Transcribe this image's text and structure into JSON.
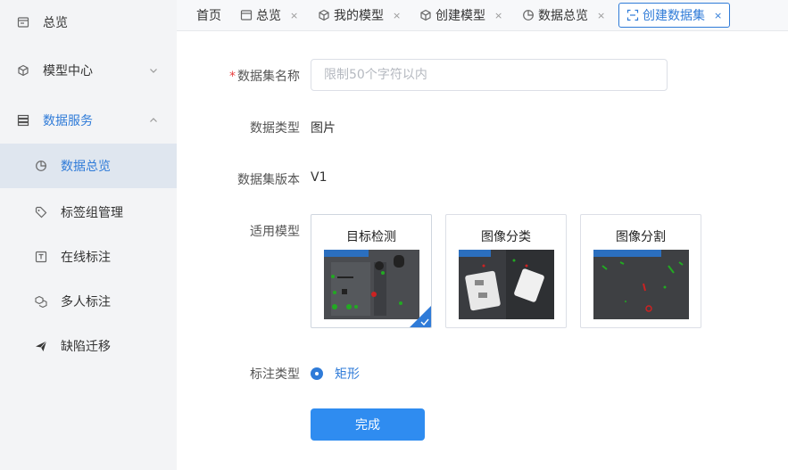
{
  "sidebar": {
    "items": [
      {
        "label": "总览",
        "icon": "overview-icon"
      },
      {
        "label": "模型中心",
        "icon": "cube-icon"
      },
      {
        "label": "数据服务",
        "icon": "database-icon"
      },
      {
        "label": "数据总览",
        "icon": "pie-chart-icon"
      },
      {
        "label": "标签组管理",
        "icon": "tag-icon"
      },
      {
        "label": "在线标注",
        "icon": "text-box-icon"
      },
      {
        "label": "多人标注",
        "icon": "multi-cube-icon"
      },
      {
        "label": "缺陷迁移",
        "icon": "send-icon"
      }
    ]
  },
  "tabs": [
    {
      "label": "首页"
    },
    {
      "label": "总览",
      "close": "×"
    },
    {
      "label": "我的模型",
      "close": "×"
    },
    {
      "label": "创建模型",
      "close": "×"
    },
    {
      "label": "数据总览",
      "close": "×"
    },
    {
      "label": "创建数据集",
      "close": "×"
    }
  ],
  "form": {
    "required_mark": "*",
    "name_label": "数据集名称",
    "name_placeholder": "限制50个字符以内",
    "name_value": "",
    "type_label": "数据类型",
    "type_value": "图片",
    "version_label": "数据集版本",
    "version_value": "V1",
    "model_label": "适用模型",
    "models": [
      {
        "title": "目标检测",
        "selected": true
      },
      {
        "title": "图像分类",
        "selected": false
      },
      {
        "title": "图像分割",
        "selected": false
      }
    ],
    "annotation_label": "标注类型",
    "annotation_option": "矩形",
    "submit_label": "完成"
  },
  "colors": {
    "accent": "#2f7bd8",
    "button": "#2f8cf0",
    "sidebar_bg": "#f3f4f6",
    "sidebar_active": "#dfe6ef",
    "required": "#e84040"
  }
}
